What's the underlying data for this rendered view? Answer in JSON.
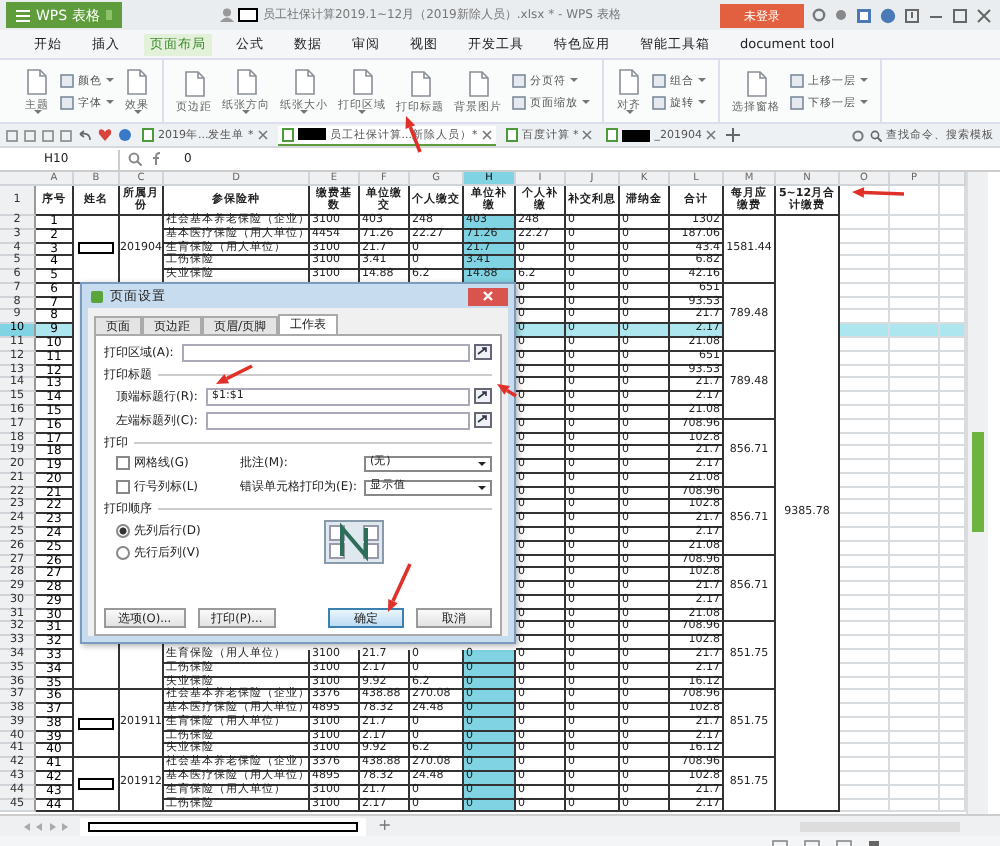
{
  "app": {
    "name": "WPS 表格",
    "title": "员工社保计算2019.1~12月（2019新除人员）.xlsx * - WPS 表格",
    "login": "未登录"
  },
  "menu": [
    {
      "label": "开始",
      "selected": false
    },
    {
      "label": "插入",
      "selected": false
    },
    {
      "label": "页面布局",
      "selected": true
    },
    {
      "label": "公式",
      "selected": false
    },
    {
      "label": "数据",
      "selected": false
    },
    {
      "label": "审阅",
      "selected": false
    },
    {
      "label": "视图",
      "selected": false
    },
    {
      "label": "开发工具",
      "selected": false
    },
    {
      "label": "特色应用",
      "selected": false
    },
    {
      "label": "智能工具箱",
      "selected": false
    },
    {
      "label": "document tool",
      "selected": false
    }
  ],
  "ribbon": [
    {
      "items": [
        {
          "kind": "large",
          "label": "主题",
          "dropdown": true
        },
        {
          "kind": "stack",
          "items": [
            {
              "label": "颜色",
              "dropdown": true
            },
            {
              "label": "字体",
              "dropdown": true
            }
          ]
        },
        {
          "kind": "large",
          "label": "效果",
          "dropdown": true
        }
      ]
    },
    {
      "items": [
        {
          "kind": "large",
          "label": "页边距",
          "dropdown": false
        },
        {
          "kind": "large",
          "label": "纸张方向",
          "dropdown": true
        },
        {
          "kind": "large",
          "label": "纸张大小",
          "dropdown": true
        },
        {
          "kind": "large",
          "label": "打印区域",
          "dropdown": true
        },
        {
          "kind": "large",
          "label": "打印标题",
          "dropdown": false
        },
        {
          "kind": "large",
          "label": "背景图片",
          "dropdown": false
        },
        {
          "kind": "stack",
          "items": [
            {
              "label": "分页符",
              "dropdown": true
            },
            {
              "label": "页面缩放",
              "dropdown": true
            }
          ]
        }
      ]
    },
    {
      "items": [
        {
          "kind": "large",
          "label": "对齐",
          "dropdown": true
        },
        {
          "kind": "stack",
          "items": [
            {
              "label": "组合",
              "dropdown": true
            },
            {
              "label": "旋转",
              "dropdown": true
            }
          ]
        }
      ]
    },
    {
      "items": [
        {
          "kind": "large",
          "label": "选择窗格",
          "dropdown": false
        },
        {
          "kind": "stack",
          "items": [
            {
              "label": "上移一层",
              "dropdown": true
            },
            {
              "label": "下移一层",
              "dropdown": true
            }
          ]
        }
      ]
    }
  ],
  "doc_tabs": [
    {
      "label": "2019年...发生单 *",
      "redacted": false,
      "selected": false
    },
    {
      "label": "员工社保计算...新除人员）*",
      "redacted": true,
      "selected": true
    },
    {
      "label": "百度计算 *",
      "redacted": false,
      "selected": false
    },
    {
      "label": "_201904",
      "redacted": true,
      "selected": false
    }
  ],
  "search": {
    "placeholder": "查找命令、搜索模板"
  },
  "formula_bar": {
    "cell": "H10",
    "value": "0"
  },
  "sheet": {
    "columns": [
      {
        "letter": "A",
        "selected": false
      },
      {
        "letter": "B",
        "selected": false
      },
      {
        "letter": "C",
        "selected": false
      },
      {
        "letter": "D",
        "selected": false
      },
      {
        "letter": "E",
        "selected": false
      },
      {
        "letter": "F",
        "selected": false
      },
      {
        "letter": "G",
        "selected": false
      },
      {
        "letter": "H",
        "selected": true
      },
      {
        "letter": "I",
        "selected": false
      },
      {
        "letter": "J",
        "selected": false
      },
      {
        "letter": "K",
        "selected": false
      },
      {
        "letter": "L",
        "selected": false
      },
      {
        "letter": "M",
        "selected": false
      },
      {
        "letter": "N",
        "selected": false
      },
      {
        "letter": "O",
        "selected": false
      },
      {
        "letter": "P",
        "selected": false
      }
    ],
    "rows": [
      {
        "n": "1",
        "kind": "header",
        "selected": false,
        "cells": {
          "A": "序号",
          "B": "姓名",
          "C": "所属月份",
          "D": "参保险种",
          "E": "缴费基数",
          "F": "单位缴交",
          "G": "个人缴交",
          "H": "单位补缴",
          "I": "个人补缴",
          "J": "补交利息",
          "K": "滞纳金",
          "L": "合计",
          "M": "每月应缴费",
          "N": "5~12月合计缴费"
        }
      },
      {
        "n": "2",
        "kind": "data",
        "group_start": true,
        "selected": false,
        "cells": {
          "A": "1",
          "B": {
            "redacted": true
          },
          "C": "201904",
          "D": "社会基本养老保险（企业）",
          "E": "3100",
          "F": "403",
          "G": "248",
          "H": "403",
          "I": "248",
          "J": "0",
          "K": "0",
          "L": "1302",
          "M": "1581.44",
          "N": "9385.78"
        }
      },
      {
        "n": "3",
        "kind": "data",
        "group_start": false,
        "selected": false,
        "cells": {
          "A": "2",
          "D": "基本医疗保险（用人单位）",
          "E": "4454",
          "F": "71.26",
          "G": "22.27",
          "H": "71.26",
          "I": "22.27",
          "J": "0",
          "K": "0",
          "L": "187.06"
        }
      },
      {
        "n": "4",
        "kind": "data",
        "group_start": false,
        "selected": false,
        "cells": {
          "A": "3",
          "D": "生育保险（用人单位）",
          "E": "3100",
          "F": "21.7",
          "G": "0",
          "H": "21.7",
          "I": "0",
          "J": "0",
          "K": "0",
          "L": "43.4"
        }
      },
      {
        "n": "5",
        "kind": "data",
        "group_start": false,
        "selected": false,
        "cells": {
          "A": "4",
          "D": "工伤保险",
          "E": "3100",
          "F": "3.41",
          "G": "0",
          "H": "3.41",
          "I": "0",
          "J": "0",
          "K": "0",
          "L": "6.82"
        }
      },
      {
        "n": "6",
        "kind": "data",
        "group_start": false,
        "selected": false,
        "cells": {
          "A": "5",
          "D": "失业保险",
          "E": "3100",
          "F": "14.88",
          "G": "6.2",
          "H": "14.88",
          "I": "6.2",
          "J": "0",
          "K": "0",
          "L": "42.16"
        }
      },
      {
        "n": "7",
        "kind": "data",
        "group_start": true,
        "selected": false,
        "cells": {
          "A": "6",
          "I": "0",
          "J": "0",
          "K": "0",
          "L": "651",
          "M": "789.48"
        }
      },
      {
        "n": "8",
        "kind": "data",
        "group_start": false,
        "selected": false,
        "cells": {
          "A": "7",
          "I": "0",
          "J": "0",
          "K": "0",
          "L": "93.53"
        }
      },
      {
        "n": "9",
        "kind": "data",
        "group_start": false,
        "selected": false,
        "cells": {
          "A": "8",
          "I": "0",
          "J": "0",
          "K": "0",
          "L": "21.7"
        }
      },
      {
        "n": "10",
        "kind": "data",
        "group_start": false,
        "selected": true,
        "cells": {
          "A": "9",
          "I": "0",
          "J": "0",
          "K": "0",
          "L": "2.17"
        }
      },
      {
        "n": "11",
        "kind": "data",
        "group_start": false,
        "selected": false,
        "cells": {
          "A": "10",
          "I": "0",
          "J": "0",
          "K": "0",
          "L": "21.08"
        }
      },
      {
        "n": "12",
        "kind": "data",
        "group_start": true,
        "selected": false,
        "cells": {
          "A": "11",
          "I": "0",
          "J": "0",
          "K": "0",
          "L": "651",
          "M": "789.48"
        }
      },
      {
        "n": "13",
        "kind": "data",
        "group_start": false,
        "selected": false,
        "cells": {
          "A": "12",
          "I": "0",
          "J": "0",
          "K": "0",
          "L": "93.53"
        }
      },
      {
        "n": "14",
        "kind": "data",
        "group_start": false,
        "selected": false,
        "cells": {
          "A": "13",
          "I": "0",
          "J": "0",
          "K": "0",
          "L": "21.7"
        }
      },
      {
        "n": "15",
        "kind": "data",
        "group_start": false,
        "selected": false,
        "cells": {
          "A": "14",
          "I": "0",
          "J": "0",
          "K": "0",
          "L": "2.17"
        }
      },
      {
        "n": "16",
        "kind": "data",
        "group_start": false,
        "selected": false,
        "cells": {
          "A": "15",
          "I": "0",
          "J": "0",
          "K": "0",
          "L": "21.08"
        }
      },
      {
        "n": "17",
        "kind": "data",
        "group_start": true,
        "selected": false,
        "cells": {
          "A": "16",
          "I": "0",
          "J": "0",
          "K": "0",
          "L": "708.96",
          "M": "856.71"
        }
      },
      {
        "n": "18",
        "kind": "data",
        "group_start": false,
        "selected": false,
        "cells": {
          "A": "17",
          "I": "0",
          "J": "0",
          "K": "0",
          "L": "102.8"
        }
      },
      {
        "n": "19",
        "kind": "data",
        "group_start": false,
        "selected": false,
        "cells": {
          "A": "18",
          "I": "0",
          "J": "0",
          "K": "0",
          "L": "21.7"
        }
      },
      {
        "n": "20",
        "kind": "data",
        "group_start": false,
        "selected": false,
        "cells": {
          "A": "19",
          "I": "0",
          "J": "0",
          "K": "0",
          "L": "2.17"
        }
      },
      {
        "n": "21",
        "kind": "data",
        "group_start": false,
        "selected": false,
        "cells": {
          "A": "20",
          "I": "0",
          "J": "0",
          "K": "0",
          "L": "21.08"
        }
      },
      {
        "n": "22",
        "kind": "data",
        "group_start": true,
        "selected": false,
        "cells": {
          "A": "21",
          "I": "0",
          "J": "0",
          "K": "0",
          "L": "708.96",
          "M": "856.71"
        }
      },
      {
        "n": "23",
        "kind": "data",
        "group_start": false,
        "selected": false,
        "cells": {
          "A": "22",
          "I": "0",
          "J": "0",
          "K": "0",
          "L": "102.8"
        }
      },
      {
        "n": "24",
        "kind": "data",
        "group_start": false,
        "selected": false,
        "cells": {
          "A": "23",
          "I": "0",
          "J": "0",
          "K": "0",
          "L": "21.7"
        }
      },
      {
        "n": "25",
        "kind": "data",
        "group_start": false,
        "selected": false,
        "cells": {
          "A": "24",
          "I": "0",
          "J": "0",
          "K": "0",
          "L": "2.17"
        }
      },
      {
        "n": "26",
        "kind": "data",
        "group_start": false,
        "selected": false,
        "cells": {
          "A": "25",
          "I": "0",
          "J": "0",
          "K": "0",
          "L": "21.08"
        }
      },
      {
        "n": "27",
        "kind": "data",
        "group_start": true,
        "selected": false,
        "cells": {
          "A": "26",
          "I": "0",
          "J": "0",
          "K": "0",
          "L": "708.96",
          "M": "856.71"
        }
      },
      {
        "n": "28",
        "kind": "data",
        "group_start": false,
        "selected": false,
        "cells": {
          "A": "27",
          "I": "0",
          "J": "0",
          "K": "0",
          "L": "102.8"
        }
      },
      {
        "n": "29",
        "kind": "data",
        "group_start": false,
        "selected": false,
        "cells": {
          "A": "28",
          "I": "0",
          "J": "0",
          "K": "0",
          "L": "21.7"
        }
      },
      {
        "n": "30",
        "kind": "data",
        "group_start": false,
        "selected": false,
        "cells": {
          "A": "29",
          "I": "0",
          "J": "0",
          "K": "0",
          "L": "2.17"
        }
      },
      {
        "n": "31",
        "kind": "data",
        "group_start": false,
        "selected": false,
        "cells": {
          "A": "30",
          "I": "0",
          "J": "0",
          "K": "0",
          "L": "21.08"
        }
      },
      {
        "n": "32",
        "kind": "data",
        "group_start": true,
        "selected": false,
        "cells": {
          "A": "31",
          "I": "0",
          "J": "0",
          "K": "0",
          "L": "708.96",
          "M": "851.75"
        }
      },
      {
        "n": "33",
        "kind": "data",
        "group_start": false,
        "selected": false,
        "cells": {
          "A": "32",
          "I": "0",
          "J": "0",
          "K": "0",
          "L": "102.8"
        }
      },
      {
        "n": "34",
        "kind": "data",
        "group_start": false,
        "selected": false,
        "cells": {
          "A": "33",
          "D": "生育保险（用人单位）",
          "E": "3100",
          "F": "21.7",
          "G": "0",
          "H": "0",
          "I": "0",
          "J": "0",
          "K": "0",
          "L": "21.7"
        }
      },
      {
        "n": "35",
        "kind": "data",
        "group_start": false,
        "selected": false,
        "cells": {
          "A": "34",
          "D": "工伤保险",
          "E": "3100",
          "F": "2.17",
          "G": "0",
          "H": "0",
          "I": "0",
          "J": "0",
          "K": "0",
          "L": "2.17"
        }
      },
      {
        "n": "36",
        "kind": "data",
        "group_start": false,
        "selected": false,
        "cells": {
          "A": "35",
          "D": "失业保险",
          "E": "3100",
          "F": "9.92",
          "G": "6.2",
          "H": "0",
          "I": "0",
          "J": "0",
          "K": "0",
          "L": "16.12"
        }
      },
      {
        "n": "37",
        "kind": "data",
        "group_start": true,
        "selected": false,
        "cells": {
          "A": "36",
          "B": {
            "redacted": true
          },
          "C": "201911",
          "D": "社会基本养老保险（企业）",
          "E": "3376",
          "F": "438.88",
          "G": "270.08",
          "H": "0",
          "I": "0",
          "J": "0",
          "K": "0",
          "L": "708.96",
          "M": "851.75"
        }
      },
      {
        "n": "38",
        "kind": "data",
        "group_start": false,
        "selected": false,
        "cells": {
          "A": "37",
          "D": "基本医疗保险（用人单位）",
          "E": "4895",
          "F": "78.32",
          "G": "24.48",
          "H": "0",
          "I": "0",
          "J": "0",
          "K": "0",
          "L": "102.8"
        }
      },
      {
        "n": "39",
        "kind": "data",
        "group_start": false,
        "selected": false,
        "cells": {
          "A": "38",
          "D": "生育保险（用人单位）",
          "E": "3100",
          "F": "21.7",
          "G": "0",
          "H": "0",
          "I": "0",
          "J": "0",
          "K": "0",
          "L": "21.7"
        }
      },
      {
        "n": "40",
        "kind": "data",
        "group_start": false,
        "selected": false,
        "cells": {
          "A": "39",
          "D": "工伤保险",
          "E": "3100",
          "F": "2.17",
          "G": "0",
          "H": "0",
          "I": "0",
          "J": "0",
          "K": "0",
          "L": "2.17"
        }
      },
      {
        "n": "41",
        "kind": "data",
        "group_start": false,
        "selected": false,
        "cells": {
          "A": "40",
          "D": "失业保险",
          "E": "3100",
          "F": "9.92",
          "G": "6.2",
          "H": "0",
          "I": "0",
          "J": "0",
          "K": "0",
          "L": "16.12"
        }
      },
      {
        "n": "42",
        "kind": "data",
        "group_start": true,
        "selected": false,
        "cells": {
          "A": "41",
          "B": {
            "redacted": true
          },
          "C": "201912",
          "D": "社会基本养老保险（企业）",
          "E": "3376",
          "F": "438.88",
          "G": "270.08",
          "H": "0",
          "I": "0",
          "J": "0",
          "K": "0",
          "L": "708.96",
          "M": "851.75"
        }
      },
      {
        "n": "43",
        "kind": "data",
        "group_start": false,
        "selected": false,
        "cells": {
          "A": "42",
          "D": "基本医疗保险（用人单位）",
          "E": "4895",
          "F": "78.32",
          "G": "24.48",
          "H": "0",
          "I": "0",
          "J": "0",
          "K": "0",
          "L": "102.8"
        }
      },
      {
        "n": "44",
        "kind": "data",
        "group_start": false,
        "selected": false,
        "cells": {
          "A": "43",
          "D": "生育保险（用人单位）",
          "E": "3100",
          "F": "21.7",
          "G": "0",
          "H": "0",
          "I": "0",
          "J": "0",
          "K": "0",
          "L": "21.7"
        }
      },
      {
        "n": "45",
        "kind": "data",
        "group_start": false,
        "selected": false,
        "cells": {
          "A": "44",
          "D": "工伤保险",
          "E": "3100",
          "F": "2.17",
          "G": "0",
          "H": "0",
          "I": "0",
          "J": "0",
          "K": "0",
          "L": "2.17"
        }
      }
    ]
  },
  "sheet_bar": {
    "add": "+"
  },
  "dialog": {
    "title": "页面设置",
    "tabs": [
      {
        "label": "页面",
        "selected": false
      },
      {
        "label": "页边距",
        "selected": false
      },
      {
        "label": "页眉/页脚",
        "selected": false
      },
      {
        "label": "工作表",
        "selected": true
      }
    ],
    "print_area": {
      "label": "打印区域(A):"
    },
    "titles_group": "打印标题",
    "title_fields": [
      {
        "label": "顶端标题行(R):",
        "value": "$1:$1"
      },
      {
        "label": "左端标题列(C):"
      }
    ],
    "print_group": "打印",
    "checkboxes": [
      {
        "label": "网格线(G)",
        "checked": false
      },
      {
        "label": "行号列标(L)",
        "checked": false
      }
    ],
    "selects": [
      {
        "label": "批注(M):",
        "value": "(无)"
      },
      {
        "label": "错误单元格打印为(E):",
        "value": "显示值"
      }
    ],
    "order_group": "打印顺序",
    "order": [
      {
        "label": "先列后行(D)",
        "selected": true
      },
      {
        "label": "先行后列(V)",
        "selected": false
      }
    ],
    "buttons": [
      {
        "label": "选项(O)...",
        "kind": "secondary"
      },
      {
        "label": "打印(P)...",
        "kind": "secondary"
      },
      {
        "label": "确定",
        "kind": "primary"
      },
      {
        "label": "取消",
        "kind": "secondary"
      }
    ]
  }
}
